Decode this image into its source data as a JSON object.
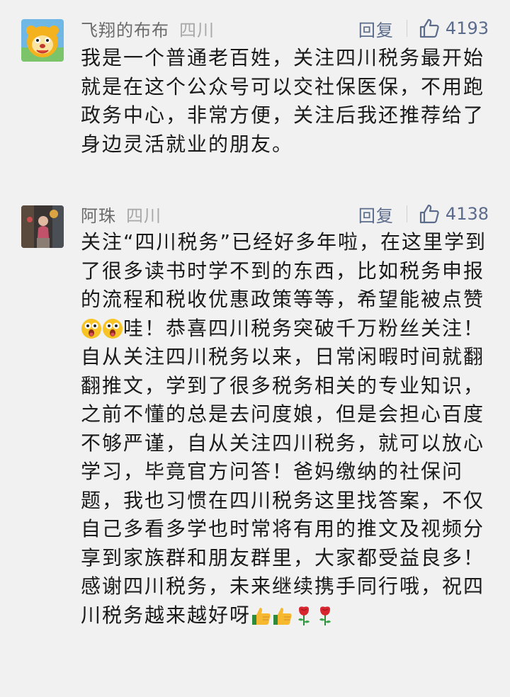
{
  "comments": [
    {
      "nickname": "飞翔的布布",
      "location": "四川",
      "reply_label": "回复",
      "likes": "4193",
      "text": "我是一个普通老百姓，关注四川税务最开始就是在这个公众号可以交社保医保，不用跑政务中心，非常方便，关注后我还推荐给了身边灵活就业的朋友。"
    },
    {
      "nickname": "阿珠",
      "location": "四川",
      "reply_label": "回复",
      "likes": "4138",
      "text_a": "关注“四川税务”已经好多年啦，在这里学到了很多读书时学不到的东西，比如税务申报的流程和税收优惠政策等等，希望能被点赞",
      "text_b": "哇！恭喜四川税务突破千万粉丝关注！自从关注四川税务以来，日常闲暇时间就翻翻推文，学到了很多税务相关的专业知识，之前不懂的总是去问度娘，但是会担心百度不够严谨，自从关注四川税务，就可以放心学习，毕竟官方问答！爸妈缴纳的社保问题，我也习惯在四川税务这里找答案，不仅自己多看多学也时常将有用的推文及视频分享到家族群和朋友群里，大家都受益良多！感谢四川税务，未来继续携手同行哦，祝四川税务越来越好呀"
    }
  ],
  "icons": {
    "avatar_1": "cartoon-lion-avatar-icon",
    "avatar_2": "photo-avatar-icon",
    "like": "thumbs-up-outline-icon",
    "emoji_surprised": "surprised-face-emoji-icon",
    "emoji_thumbs": "thumbs-up-emoji-icon",
    "emoji_rose": "rose-emoji-icon"
  },
  "colors": {
    "background": "#f1f1f1",
    "link_blue": "#5b6b8c",
    "nickname_gray": "#6b6b6b",
    "body_text": "#1a1a1a"
  }
}
